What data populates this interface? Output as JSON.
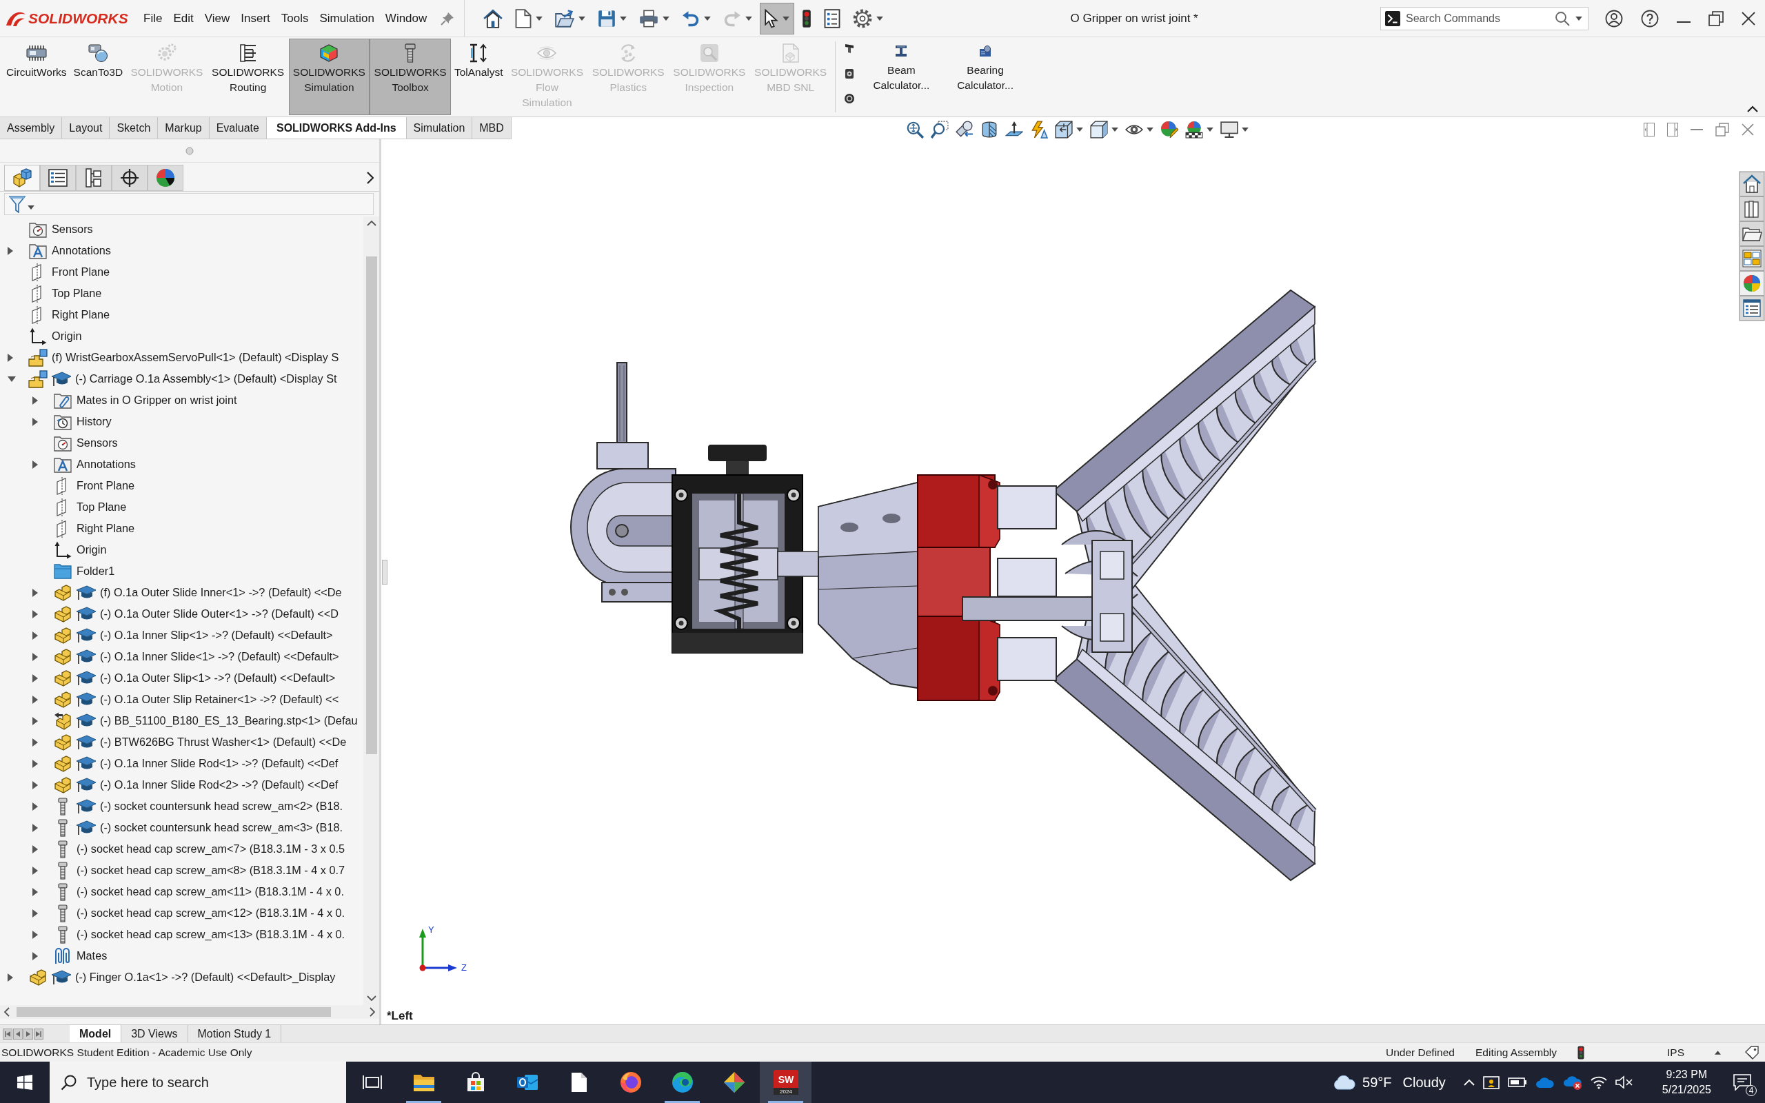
{
  "title_bar": {
    "logo": "SOLIDWORKS",
    "menu": [
      "File",
      "Edit",
      "View",
      "Insert",
      "Tools",
      "Simulation",
      "Window"
    ],
    "document_title": "O Gripper on wrist joint *",
    "search": {
      "placeholder": "Search Commands"
    }
  },
  "quick_access": [
    {
      "kind": "home",
      "dropdown": false,
      "pressed": false,
      "disabled": false
    },
    {
      "kind": "new",
      "dropdown": true,
      "pressed": false,
      "disabled": false
    },
    {
      "kind": "open",
      "dropdown": true,
      "pressed": false,
      "disabled": false
    },
    {
      "kind": "save",
      "dropdown": true,
      "pressed": false,
      "disabled": false
    },
    {
      "kind": "print",
      "dropdown": true,
      "pressed": false,
      "disabled": false
    },
    {
      "kind": "undo",
      "dropdown": true,
      "pressed": false,
      "disabled": false
    },
    {
      "kind": "redo",
      "dropdown": true,
      "pressed": false,
      "disabled": true
    },
    {
      "kind": "select",
      "dropdown": true,
      "pressed": true,
      "disabled": false
    },
    {
      "kind": "rebuild",
      "dropdown": false,
      "pressed": false,
      "disabled": false
    },
    {
      "kind": "file-properties",
      "dropdown": false,
      "pressed": false,
      "disabled": false
    },
    {
      "kind": "options",
      "dropdown": true,
      "pressed": false,
      "disabled": false
    }
  ],
  "command_manager": {
    "add_ins": [
      {
        "kind": "circuitworks",
        "label": "CircuitWorks",
        "pressed": false,
        "disabled": false
      },
      {
        "kind": "scanto3d",
        "label": "ScanTo3D",
        "pressed": false,
        "disabled": false
      },
      {
        "kind": "motion",
        "label": "SOLIDWORKS Motion",
        "pressed": false,
        "disabled": true
      },
      {
        "kind": "routing",
        "label": "SOLIDWORKS Routing",
        "pressed": false,
        "disabled": false
      },
      {
        "kind": "simulation",
        "label": "SOLIDWORKS Simulation",
        "pressed": true,
        "disabled": false
      },
      {
        "kind": "toolbox",
        "label": "SOLIDWORKS Toolbox",
        "pressed": true,
        "disabled": false
      },
      {
        "kind": "tolanalyst",
        "label": "TolAnalyst",
        "pressed": false,
        "disabled": false
      },
      {
        "kind": "flow",
        "label": "SOLIDWORKS Flow Simulation",
        "pressed": false,
        "disabled": true
      },
      {
        "kind": "plastics",
        "label": "SOLIDWORKS Plastics",
        "pressed": false,
        "disabled": true
      },
      {
        "kind": "inspection",
        "label": "SOLIDWORKS Inspection",
        "pressed": false,
        "disabled": true
      },
      {
        "kind": "mbd",
        "label": "SOLIDWORKS MBD SNL",
        "pressed": false,
        "disabled": true
      }
    ],
    "calculators": [
      {
        "kind": "beam",
        "label": "Beam Calculator..."
      },
      {
        "kind": "bearing",
        "label": "Bearing Calculator..."
      }
    ]
  },
  "tabs": [
    {
      "label": "Assembly",
      "selected": false
    },
    {
      "label": "Layout",
      "selected": false
    },
    {
      "label": "Sketch",
      "selected": false
    },
    {
      "label": "Markup",
      "selected": false
    },
    {
      "label": "Evaluate",
      "selected": false
    },
    {
      "label": "SOLIDWORKS Add-Ins",
      "selected": true
    },
    {
      "label": "Simulation",
      "selected": false
    },
    {
      "label": "MBD",
      "selected": false
    }
  ],
  "feature_manager": {
    "tabs": [
      {
        "kind": "feature-tree",
        "selected": true
      },
      {
        "kind": "property",
        "selected": false
      },
      {
        "kind": "configuration",
        "selected": false
      },
      {
        "kind": "dimxpert",
        "selected": false
      },
      {
        "kind": "display",
        "selected": false
      }
    ],
    "tree": [
      {
        "kind": "sensors",
        "label": "Sensors",
        "expandable": false,
        "expanded": false,
        "educational": false
      },
      {
        "kind": "annotations",
        "label": "Annotations",
        "expandable": true,
        "expanded": false,
        "educational": false
      },
      {
        "kind": "plane",
        "label": "Front Plane",
        "expandable": false,
        "expanded": false,
        "educational": false
      },
      {
        "kind": "plane",
        "label": "Top Plane",
        "expandable": false,
        "expanded": false,
        "educational": false
      },
      {
        "kind": "plane",
        "label": "Right Plane",
        "expandable": false,
        "expanded": false,
        "educational": false
      },
      {
        "kind": "origin",
        "label": "Origin",
        "expandable": false,
        "expanded": false,
        "educational": false
      },
      {
        "kind": "assembly",
        "label": "(f) WristGearboxAssemServoPull<1> (Default) <Display S",
        "expandable": true,
        "expanded": false,
        "educational": false
      },
      {
        "kind": "assembly",
        "label": "(-) Carriage O.1a Assembly<1> (Default) <Display St",
        "expandable": true,
        "expanded": true,
        "educational": true,
        "children": [
          {
            "kind": "mates-folder",
            "label": "Mates in O Gripper on wrist joint",
            "expandable": true,
            "expanded": false,
            "educational": false
          },
          {
            "kind": "history",
            "label": "History",
            "expandable": true,
            "expanded": false,
            "educational": false
          },
          {
            "kind": "sensors",
            "label": "Sensors",
            "expandable": false,
            "expanded": false,
            "educational": false
          },
          {
            "kind": "annotations",
            "label": "Annotations",
            "expandable": true,
            "expanded": false,
            "educational": false
          },
          {
            "kind": "plane",
            "label": "Front Plane",
            "expandable": false,
            "expanded": false,
            "educational": false
          },
          {
            "kind": "plane",
            "label": "Top Plane",
            "expandable": false,
            "expanded": false,
            "educational": false
          },
          {
            "kind": "plane",
            "label": "Right Plane",
            "expandable": false,
            "expanded": false,
            "educational": false
          },
          {
            "kind": "origin",
            "label": "Origin",
            "expandable": false,
            "expanded": false,
            "educational": false
          },
          {
            "kind": "folder",
            "label": "Folder1",
            "expandable": false,
            "expanded": false,
            "educational": false
          },
          {
            "kind": "part",
            "label": "(f) O.1a Outer Slide Inner<1> ->? (Default) <<De",
            "expandable": true,
            "expanded": false,
            "educational": true
          },
          {
            "kind": "part",
            "label": "(-) O.1a Outer Slide Outer<1> ->? (Default) <<D",
            "expandable": true,
            "expanded": false,
            "educational": true
          },
          {
            "kind": "part",
            "label": "(-) O.1a Inner Slip<1> ->? (Default) <<Default>",
            "expandable": true,
            "expanded": false,
            "educational": true
          },
          {
            "kind": "part",
            "label": "(-) O.1a Inner Slide<1> ->? (Default) <<Default>",
            "expandable": true,
            "expanded": false,
            "educational": true
          },
          {
            "kind": "part",
            "label": "(-) O.1a Outer Slip<1> ->? (Default) <<Default>",
            "expandable": true,
            "expanded": false,
            "educational": true
          },
          {
            "kind": "part",
            "label": "(-) O.1a Outer Slip Retainer<1> ->? (Default) <<",
            "expandable": true,
            "expanded": false,
            "educational": true
          },
          {
            "kind": "imported-part",
            "label": "(-) BB_51100_B180_ES_13_Bearing.stp<1> (Defau",
            "expandable": true,
            "expanded": false,
            "educational": true
          },
          {
            "kind": "part",
            "label": "(-) BTW626BG Thrust Washer<1> (Default) <<De",
            "expandable": true,
            "expanded": false,
            "educational": true
          },
          {
            "kind": "part",
            "label": "(-) O.1a Inner Slide Rod<1> ->? (Default) <<Def",
            "expandable": true,
            "expanded": false,
            "educational": true
          },
          {
            "kind": "part",
            "label": "(-) O.1a Inner Slide Rod<2> ->? (Default) <<Def",
            "expandable": true,
            "expanded": false,
            "educational": true
          },
          {
            "kind": "screw",
            "label": "(-) socket countersunk head screw_am<2> (B18.",
            "expandable": true,
            "expanded": false,
            "educational": true
          },
          {
            "kind": "screw",
            "label": "(-) socket countersunk head screw_am<3> (B18.",
            "expandable": true,
            "expanded": false,
            "educational": true
          },
          {
            "kind": "screw",
            "label": "(-) socket head cap screw_am<7> (B18.3.1M - 3 x 0.5",
            "expandable": true,
            "expanded": false,
            "educational": false
          },
          {
            "kind": "screw",
            "label": "(-) socket head cap screw_am<8> (B18.3.1M - 4 x 0.7",
            "expandable": true,
            "expanded": false,
            "educational": false
          },
          {
            "kind": "screw",
            "label": "(-) socket head cap screw_am<11> (B18.3.1M - 4 x 0.",
            "expandable": true,
            "expanded": false,
            "educational": false
          },
          {
            "kind": "screw",
            "label": "(-) socket head cap screw_am<12> (B18.3.1M - 4 x 0.",
            "expandable": true,
            "expanded": false,
            "educational": false
          },
          {
            "kind": "screw",
            "label": "(-) socket head cap screw_am<13> (B18.3.1M - 4 x 0.",
            "expandable": true,
            "expanded": false,
            "educational": false
          },
          {
            "kind": "mates",
            "label": "Mates",
            "expandable": true,
            "expanded": false,
            "educational": false
          }
        ]
      },
      {
        "kind": "part",
        "label": "(-) Finger O.1a<1> ->? (Default) <<Default>_Display",
        "expandable": true,
        "expanded": false,
        "educational": true
      }
    ]
  },
  "graphics": {
    "view_label": "*Left",
    "triad": {
      "y_label": "Y",
      "z_label": "Z"
    }
  },
  "bottom_tabs": [
    {
      "label": "Model",
      "selected": true
    },
    {
      "label": "3D Views",
      "selected": false
    },
    {
      "label": "Motion Study 1",
      "selected": false
    }
  ],
  "status_bar": {
    "edition": "SOLIDWORKS Student Edition - Academic Use Only",
    "rebuild_state": "Under Defined",
    "mode": "Editing Assembly",
    "units": "IPS"
  },
  "taskbar": {
    "search": {
      "placeholder": "Type here to search"
    },
    "apps": [
      {
        "kind": "task-view",
        "running": false,
        "active": false
      },
      {
        "kind": "file-explorer",
        "running": true,
        "active": false
      },
      {
        "kind": "store",
        "running": false,
        "active": false
      },
      {
        "kind": "mail",
        "running": false,
        "active": false
      },
      {
        "kind": "document",
        "running": false,
        "active": false
      },
      {
        "kind": "firefox",
        "running": false,
        "active": false
      },
      {
        "kind": "edge",
        "running": true,
        "active": false
      },
      {
        "kind": "diamond",
        "running": false,
        "active": false
      },
      {
        "kind": "solidworks",
        "label": "SW",
        "caption": "2024",
        "running": true,
        "active": true
      }
    ],
    "weather": {
      "temperature": "59°F",
      "condition": "Cloudy"
    },
    "time": "9:23 PM",
    "date": "5/21/2025",
    "notifications": "4"
  }
}
